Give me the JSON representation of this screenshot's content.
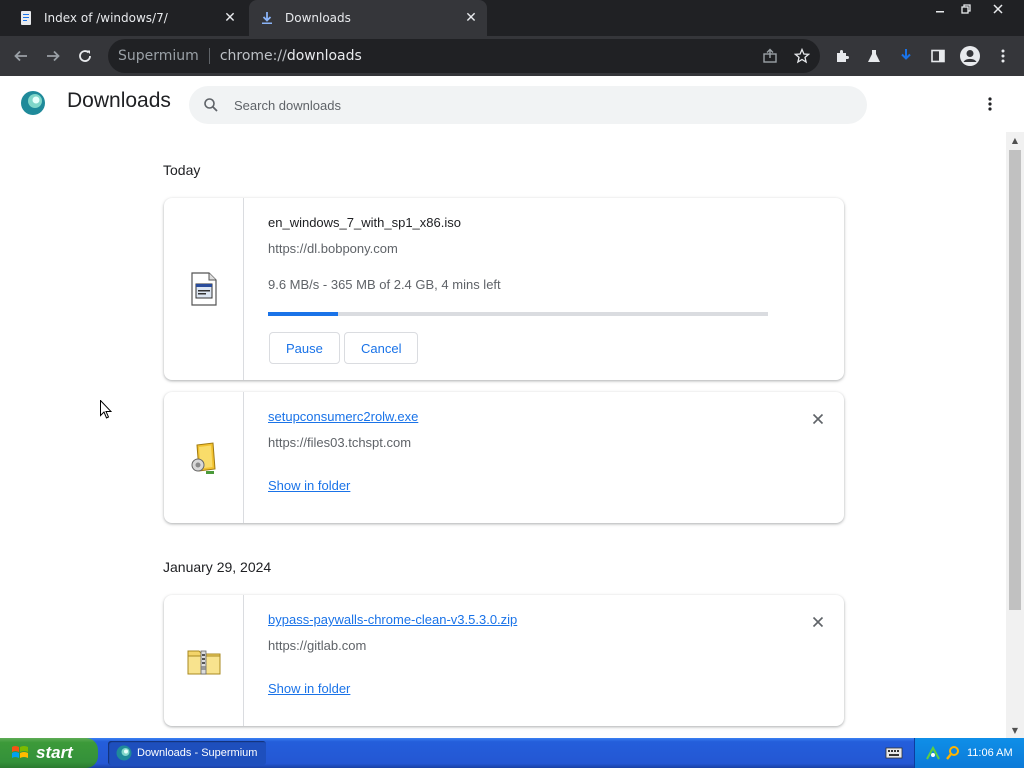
{
  "tabs": [
    {
      "title": "Index of /windows/7/",
      "icon": "document-icon",
      "active": false
    },
    {
      "title": "Downloads",
      "icon": "download-icon",
      "active": true
    }
  ],
  "window_controls": {
    "minimize": "minimize-icon",
    "restore": "restore-icon",
    "close": "close-icon"
  },
  "toolbar": {
    "site_name": "Supermium",
    "url_scheme": "chrome://",
    "url_host": "downloads"
  },
  "page": {
    "title": "Downloads",
    "search_placeholder": "Search downloads"
  },
  "groups": [
    {
      "date": "Today",
      "items": [
        {
          "file_name": "en_windows_7_with_sp1_x86.iso",
          "url": "https://dl.bobpony.com",
          "status": "9.6 MB/s - 365 MB of 2.4 GB, 4 mins left",
          "progress": 0.14,
          "buttons": [
            "Pause",
            "Cancel"
          ],
          "icon": "iso-file-icon"
        },
        {
          "file_name": "setupconsumerc2rolw.exe",
          "url": "https://files03.tchspt.com",
          "link_label": "Show in folder",
          "icon": "installer-icon"
        }
      ]
    },
    {
      "date": "January 29, 2024",
      "items": [
        {
          "file_name": "bypass-paywalls-chrome-clean-v3.5.3.0.zip",
          "url": "https://gitlab.com",
          "link_label": "Show in folder",
          "icon": "zip-folder-icon"
        }
      ]
    }
  ],
  "taskbar": {
    "start_label": "start",
    "task_title": "Downloads - Supermium",
    "clock": "11:06 AM"
  },
  "colors": {
    "accent": "#1a73e8",
    "tab_bar": "#202124",
    "toolbar": "#35363a",
    "taskbar": "#245edb",
    "start_button": "#3c9a39"
  }
}
